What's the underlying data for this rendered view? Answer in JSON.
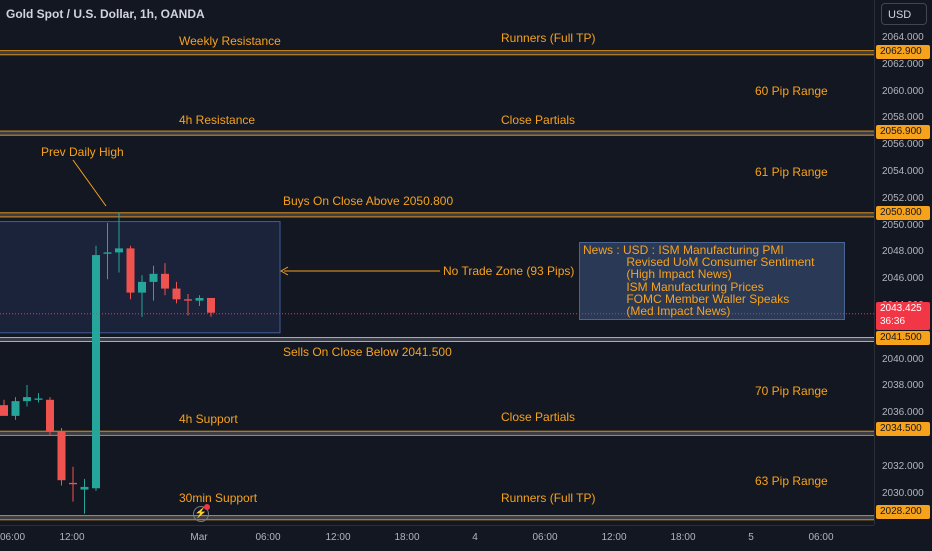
{
  "header": {
    "symbol": "Gold Spot / U.S. Dollar, 1h, OANDA",
    "currency_button": "USD"
  },
  "colors": {
    "background": "#131722",
    "level_line": "#f7a21b",
    "up": "#26a69a",
    "down": "#ef5350",
    "zone_fill": "#1e2a45",
    "zone_border": "#3f5f99"
  },
  "annotations": {
    "weekly_resistance": "Weekly Resistance",
    "runners_top": "Runners (Full TP)",
    "range_60": "60 Pip Range",
    "h4_resistance": "4h Resistance",
    "close_partials_top": "Close Partials",
    "prev_daily_high": "Prev Daily High",
    "range_61": "61 Pip Range",
    "buys_above": "Buys On Close Above 2050.800",
    "no_trade_zone": "No Trade Zone (93 Pips)",
    "sells_below": "Sells On Close Below 2041.500",
    "range_70": "70 Pip Range",
    "h4_support": "4h Support",
    "close_partials_bottom": "Close Partials",
    "range_63": "63 Pip Range",
    "min30_support": "30min Support",
    "runners_bottom": "Runners (Full TP)"
  },
  "news": {
    "lines": [
      "News : USD : ISM Manufacturing PMI",
      "             Revised UoM Consumer Sentiment",
      "             (High Impact News)",
      "             ISM Manufacturing Prices",
      "             FOMC Member Waller Speaks",
      "             (Med Impact News)"
    ]
  },
  "levels": [
    2062.9,
    2056.9,
    2050.8,
    2041.5,
    2034.5,
    2028.2
  ],
  "level_labels": [
    "2062.900",
    "2056.900",
    "2050.800",
    "2041.500",
    "2034.500",
    "2028.200"
  ],
  "current_price": {
    "price": "2043.425",
    "countdown": "36:36",
    "value": 2043.425
  },
  "y_axis": {
    "labels": [
      "2064.000",
      "2062.000",
      "2060.000",
      "2058.000",
      "2056.000",
      "2054.000",
      "2052.000",
      "2050.000",
      "2048.000",
      "2046.000",
      "2044.000",
      "2040.000",
      "2038.000",
      "2036.000",
      "2032.000",
      "2030.000"
    ],
    "values": [
      2064,
      2062,
      2060,
      2058,
      2056,
      2054,
      2052,
      2050,
      2048,
      2046,
      2044,
      2040,
      2038,
      2036,
      2032,
      2030
    ]
  },
  "x_axis": {
    "labels": [
      "06:00",
      "12:00",
      "Mar",
      "06:00",
      "12:00",
      "18:00",
      "4",
      "06:00",
      "12:00",
      "18:00",
      "5",
      "06:00"
    ]
  },
  "no_trade_zone": {
    "high": 2050.3,
    "low": 2042.0
  },
  "candles": [
    {
      "o": 2036.6,
      "h": 2037.0,
      "l": 2035.9,
      "c": 2035.8
    },
    {
      "o": 2035.8,
      "h": 2037.2,
      "l": 2035.5,
      "c": 2036.9
    },
    {
      "o": 2036.9,
      "h": 2038.1,
      "l": 2036.5,
      "c": 2037.2
    },
    {
      "o": 2037.0,
      "h": 2037.5,
      "l": 2036.8,
      "c": 2037.1
    },
    {
      "o": 2037.0,
      "h": 2037.2,
      "l": 2034.3,
      "c": 2034.6
    },
    {
      "o": 2034.6,
      "h": 2034.9,
      "l": 2030.6,
      "c": 2031.0
    },
    {
      "o": 2030.8,
      "h": 2032.0,
      "l": 2029.4,
      "c": 2030.7
    },
    {
      "o": 2030.3,
      "h": 2031.1,
      "l": 2028.5,
      "c": 2030.5
    },
    {
      "o": 2030.4,
      "h": 2048.5,
      "l": 2030.2,
      "c": 2047.8
    },
    {
      "o": 2047.9,
      "h": 2050.2,
      "l": 2046.0,
      "c": 2048.0
    },
    {
      "o": 2048.0,
      "h": 2051.0,
      "l": 2046.5,
      "c": 2048.3
    },
    {
      "o": 2048.3,
      "h": 2048.5,
      "l": 2044.5,
      "c": 2045.0
    },
    {
      "o": 2045.0,
      "h": 2046.3,
      "l": 2043.2,
      "c": 2045.8
    },
    {
      "o": 2045.8,
      "h": 2047.0,
      "l": 2044.4,
      "c": 2046.4
    },
    {
      "o": 2046.4,
      "h": 2047.2,
      "l": 2044.8,
      "c": 2045.3
    },
    {
      "o": 2045.3,
      "h": 2045.8,
      "l": 2044.2,
      "c": 2044.5
    },
    {
      "o": 2044.5,
      "h": 2044.9,
      "l": 2043.3,
      "c": 2044.4
    },
    {
      "o": 2044.4,
      "h": 2044.8,
      "l": 2044.0,
      "c": 2044.6
    },
    {
      "o": 2044.6,
      "h": 2044.6,
      "l": 2043.2,
      "c": 2043.5
    }
  ]
}
